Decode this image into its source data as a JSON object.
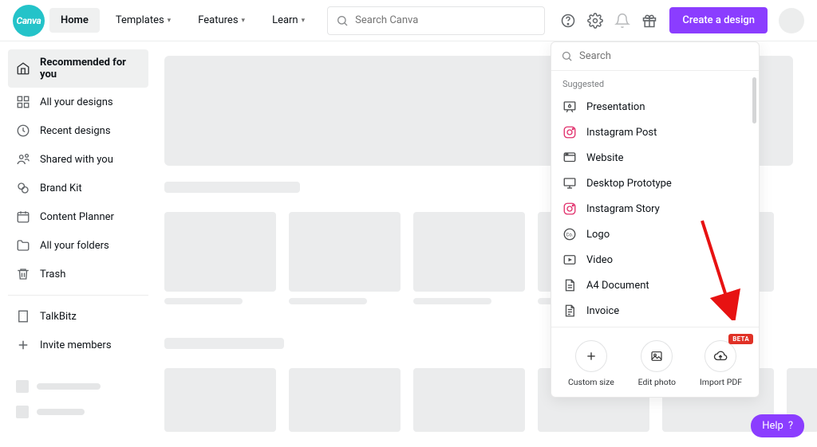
{
  "header": {
    "logo_text": "Canva",
    "nav": [
      "Home",
      "Templates",
      "Features",
      "Learn"
    ],
    "search_placeholder": "Search Canva",
    "create_label": "Create a design"
  },
  "sidebar": {
    "items": [
      {
        "label": "Recommended for you",
        "icon": "home"
      },
      {
        "label": "All your designs",
        "icon": "grid"
      },
      {
        "label": "Recent designs",
        "icon": "clock"
      },
      {
        "label": "Shared with you",
        "icon": "share"
      },
      {
        "label": "Brand Kit",
        "icon": "brand"
      },
      {
        "label": "Content Planner",
        "icon": "calendar"
      },
      {
        "label": "All your folders",
        "icon": "folder"
      },
      {
        "label": "Trash",
        "icon": "trash"
      }
    ],
    "team_label": "TalkBitz",
    "invite_label": "Invite members"
  },
  "popover": {
    "search_placeholder": "Search",
    "suggested_label": "Suggested",
    "items": [
      {
        "label": "Presentation",
        "icon": "presentation"
      },
      {
        "label": "Instagram Post",
        "icon": "instagram"
      },
      {
        "label": "Website",
        "icon": "website"
      },
      {
        "label": "Desktop Prototype",
        "icon": "desktop"
      },
      {
        "label": "Instagram Story",
        "icon": "instagram"
      },
      {
        "label": "Logo",
        "icon": "logo"
      },
      {
        "label": "Video",
        "icon": "video"
      },
      {
        "label": "A4 Document",
        "icon": "doc"
      },
      {
        "label": "Invoice",
        "icon": "doc"
      }
    ],
    "actions": {
      "custom": "Custom size",
      "edit": "Edit photo",
      "import": "Import PDF",
      "beta": "BETA"
    }
  },
  "help_label": "Help",
  "colors": {
    "accent": "#8b3dff",
    "logo": "#24c3c9",
    "arrow": "#e71212",
    "beta": "#e03126"
  }
}
